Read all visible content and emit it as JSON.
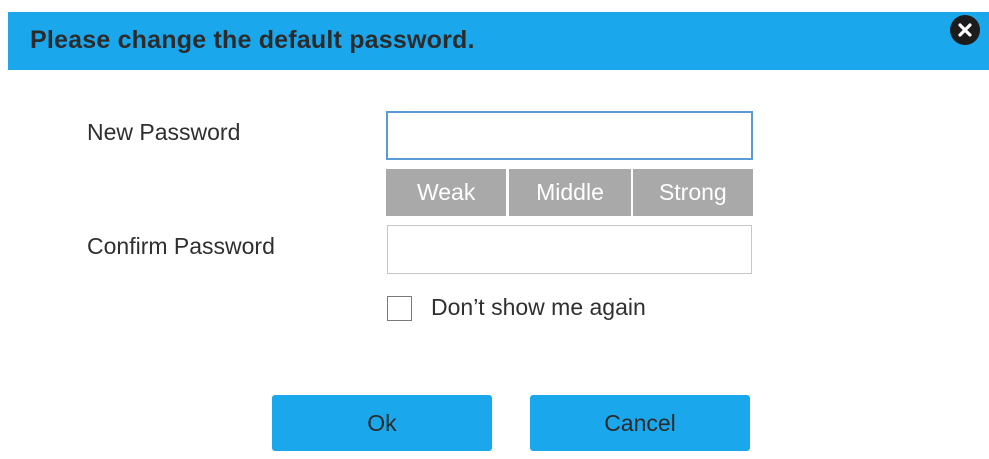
{
  "dialog": {
    "title": "Please change the default password.",
    "close_icon": "close-circle-icon"
  },
  "form": {
    "new_password_label": "New Password",
    "new_password_value": "",
    "confirm_password_label": "Confirm Password",
    "confirm_password_value": "",
    "strength_levels": [
      "Weak",
      "Middle",
      "Strong"
    ],
    "dont_show_label": "Don’t show me again",
    "dont_show_checked": false
  },
  "buttons": {
    "ok_label": "Ok",
    "cancel_label": "Cancel"
  },
  "colors": {
    "accent": "#1aa7ec",
    "strength_inactive": "#a9a9a9",
    "input_focus_border": "#5b9bd5"
  }
}
